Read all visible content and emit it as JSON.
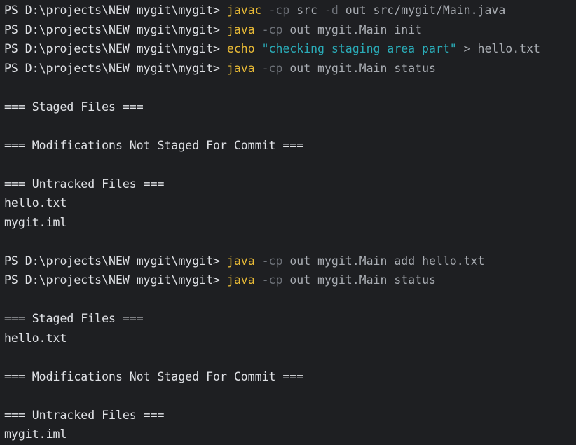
{
  "terminal": {
    "prompt": "PS D:\\projects\\NEW mygit\\mygit> ",
    "lines": [
      {
        "type": "cmd",
        "tokens": [
          {
            "cls": "cmd",
            "text": "javac"
          },
          {
            "cls": "flag",
            "text": " -cp"
          },
          {
            "cls": "arg",
            "text": " src"
          },
          {
            "cls": "flag",
            "text": " -d"
          },
          {
            "cls": "arg",
            "text": " out src/mygit/Main.java"
          }
        ]
      },
      {
        "type": "cmd",
        "tokens": [
          {
            "cls": "cmd",
            "text": "java"
          },
          {
            "cls": "flag",
            "text": " -cp"
          },
          {
            "cls": "arg",
            "text": " out mygit.Main init"
          }
        ]
      },
      {
        "type": "cmd",
        "tokens": [
          {
            "cls": "cmd",
            "text": "echo"
          },
          {
            "cls": "str",
            "text": " \"checking staging area part\""
          },
          {
            "cls": "arg",
            "text": " > hello.txt"
          }
        ]
      },
      {
        "type": "cmd",
        "tokens": [
          {
            "cls": "cmd",
            "text": "java"
          },
          {
            "cls": "flag",
            "text": " -cp"
          },
          {
            "cls": "arg",
            "text": " out mygit.Main status"
          }
        ]
      },
      {
        "type": "blank"
      },
      {
        "type": "out",
        "text": "=== Staged Files ==="
      },
      {
        "type": "blank"
      },
      {
        "type": "out",
        "text": "=== Modifications Not Staged For Commit ==="
      },
      {
        "type": "blank"
      },
      {
        "type": "out",
        "text": "=== Untracked Files ==="
      },
      {
        "type": "out",
        "text": "hello.txt"
      },
      {
        "type": "out",
        "text": "mygit.iml"
      },
      {
        "type": "blank"
      },
      {
        "type": "cmd",
        "tokens": [
          {
            "cls": "cmd",
            "text": "java"
          },
          {
            "cls": "flag",
            "text": " -cp"
          },
          {
            "cls": "arg",
            "text": " out mygit.Main add hello.txt"
          }
        ]
      },
      {
        "type": "cmd",
        "tokens": [
          {
            "cls": "cmd",
            "text": "java"
          },
          {
            "cls": "flag",
            "text": " -cp"
          },
          {
            "cls": "arg",
            "text": " out mygit.Main status"
          }
        ]
      },
      {
        "type": "blank"
      },
      {
        "type": "out",
        "text": "=== Staged Files ==="
      },
      {
        "type": "out",
        "text": "hello.txt"
      },
      {
        "type": "blank"
      },
      {
        "type": "out",
        "text": "=== Modifications Not Staged For Commit ==="
      },
      {
        "type": "blank"
      },
      {
        "type": "out",
        "text": "=== Untracked Files ==="
      },
      {
        "type": "out",
        "text": "mygit.iml"
      }
    ]
  },
  "colors": {
    "background": "#1e1f22",
    "command": "#e8ba36",
    "flag": "#6f737a",
    "argument": "#a9adb3",
    "string": "#2aacb8",
    "output": "#dfe1e5"
  }
}
